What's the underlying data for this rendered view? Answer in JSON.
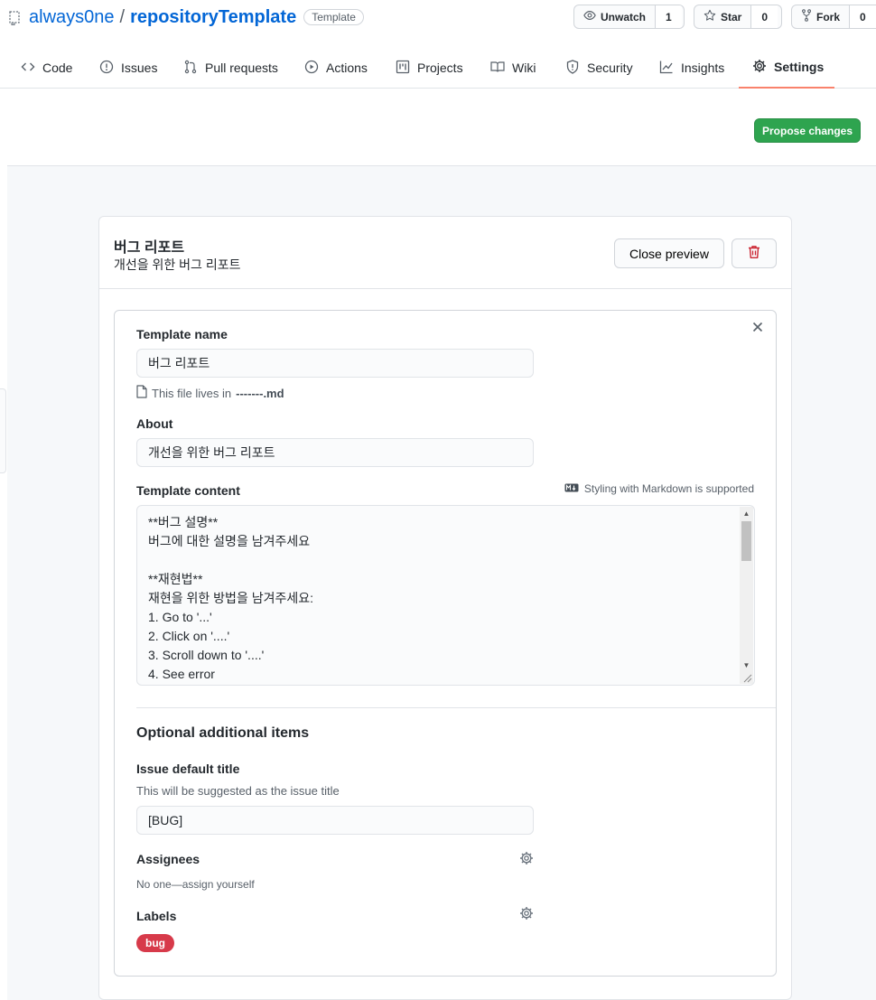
{
  "repo": {
    "owner": "always0ne",
    "separator": "/",
    "name": "repositoryTemplate",
    "badge": "Template"
  },
  "header_buttons": {
    "unwatch": {
      "label": "Unwatch",
      "count": "1"
    },
    "star": {
      "label": "Star",
      "count": "0"
    },
    "fork": {
      "label": "Fork",
      "count": "0"
    }
  },
  "tabs": [
    {
      "label": "Code",
      "icon": "code-icon"
    },
    {
      "label": "Issues",
      "icon": "issue-icon"
    },
    {
      "label": "Pull requests",
      "icon": "pull-request-icon"
    },
    {
      "label": "Actions",
      "icon": "play-icon"
    },
    {
      "label": "Projects",
      "icon": "project-icon"
    },
    {
      "label": "Wiki",
      "icon": "book-icon"
    },
    {
      "label": "Security",
      "icon": "shield-icon"
    },
    {
      "label": "Insights",
      "icon": "graph-icon"
    },
    {
      "label": "Settings",
      "icon": "gear-icon",
      "active": true
    }
  ],
  "propose_button": "Propose changes",
  "template_card": {
    "title": "버그 리포트",
    "subtitle": "개선을 위한 버그 리포트",
    "close_preview": "Close preview"
  },
  "form": {
    "template_name_label": "Template name",
    "template_name_value": "버그 리포트",
    "file_note_prefix": "This file lives in",
    "file_note_path": "-------.md",
    "about_label": "About",
    "about_value": "개선을 위한 버그 리포트",
    "content_label": "Template content",
    "markdown_note": "Styling with Markdown is supported",
    "content_value": "**버그 설명**\n버그에 대한 설명을 남겨주세요\n\n**재현법**\n재현을 위한 방법을 남겨주세요:\n1. Go to '...'\n2. Click on '....'\n3. Scroll down to '....'\n4. See error",
    "optional_title": "Optional additional items",
    "issue_title_label": "Issue default title",
    "issue_title_hint": "This will be suggested as the issue title",
    "issue_title_value": "[BUG]",
    "assignees_label": "Assignees",
    "assignees_note": "No one—assign yourself",
    "labels_label": "Labels",
    "label_pill": "bug"
  },
  "colors": {
    "link": "#0366d6",
    "primary_green": "#2ea44f",
    "active_tab_underline": "#f9826c",
    "danger": "#cb2431",
    "bug_label": "#d73a4a"
  }
}
